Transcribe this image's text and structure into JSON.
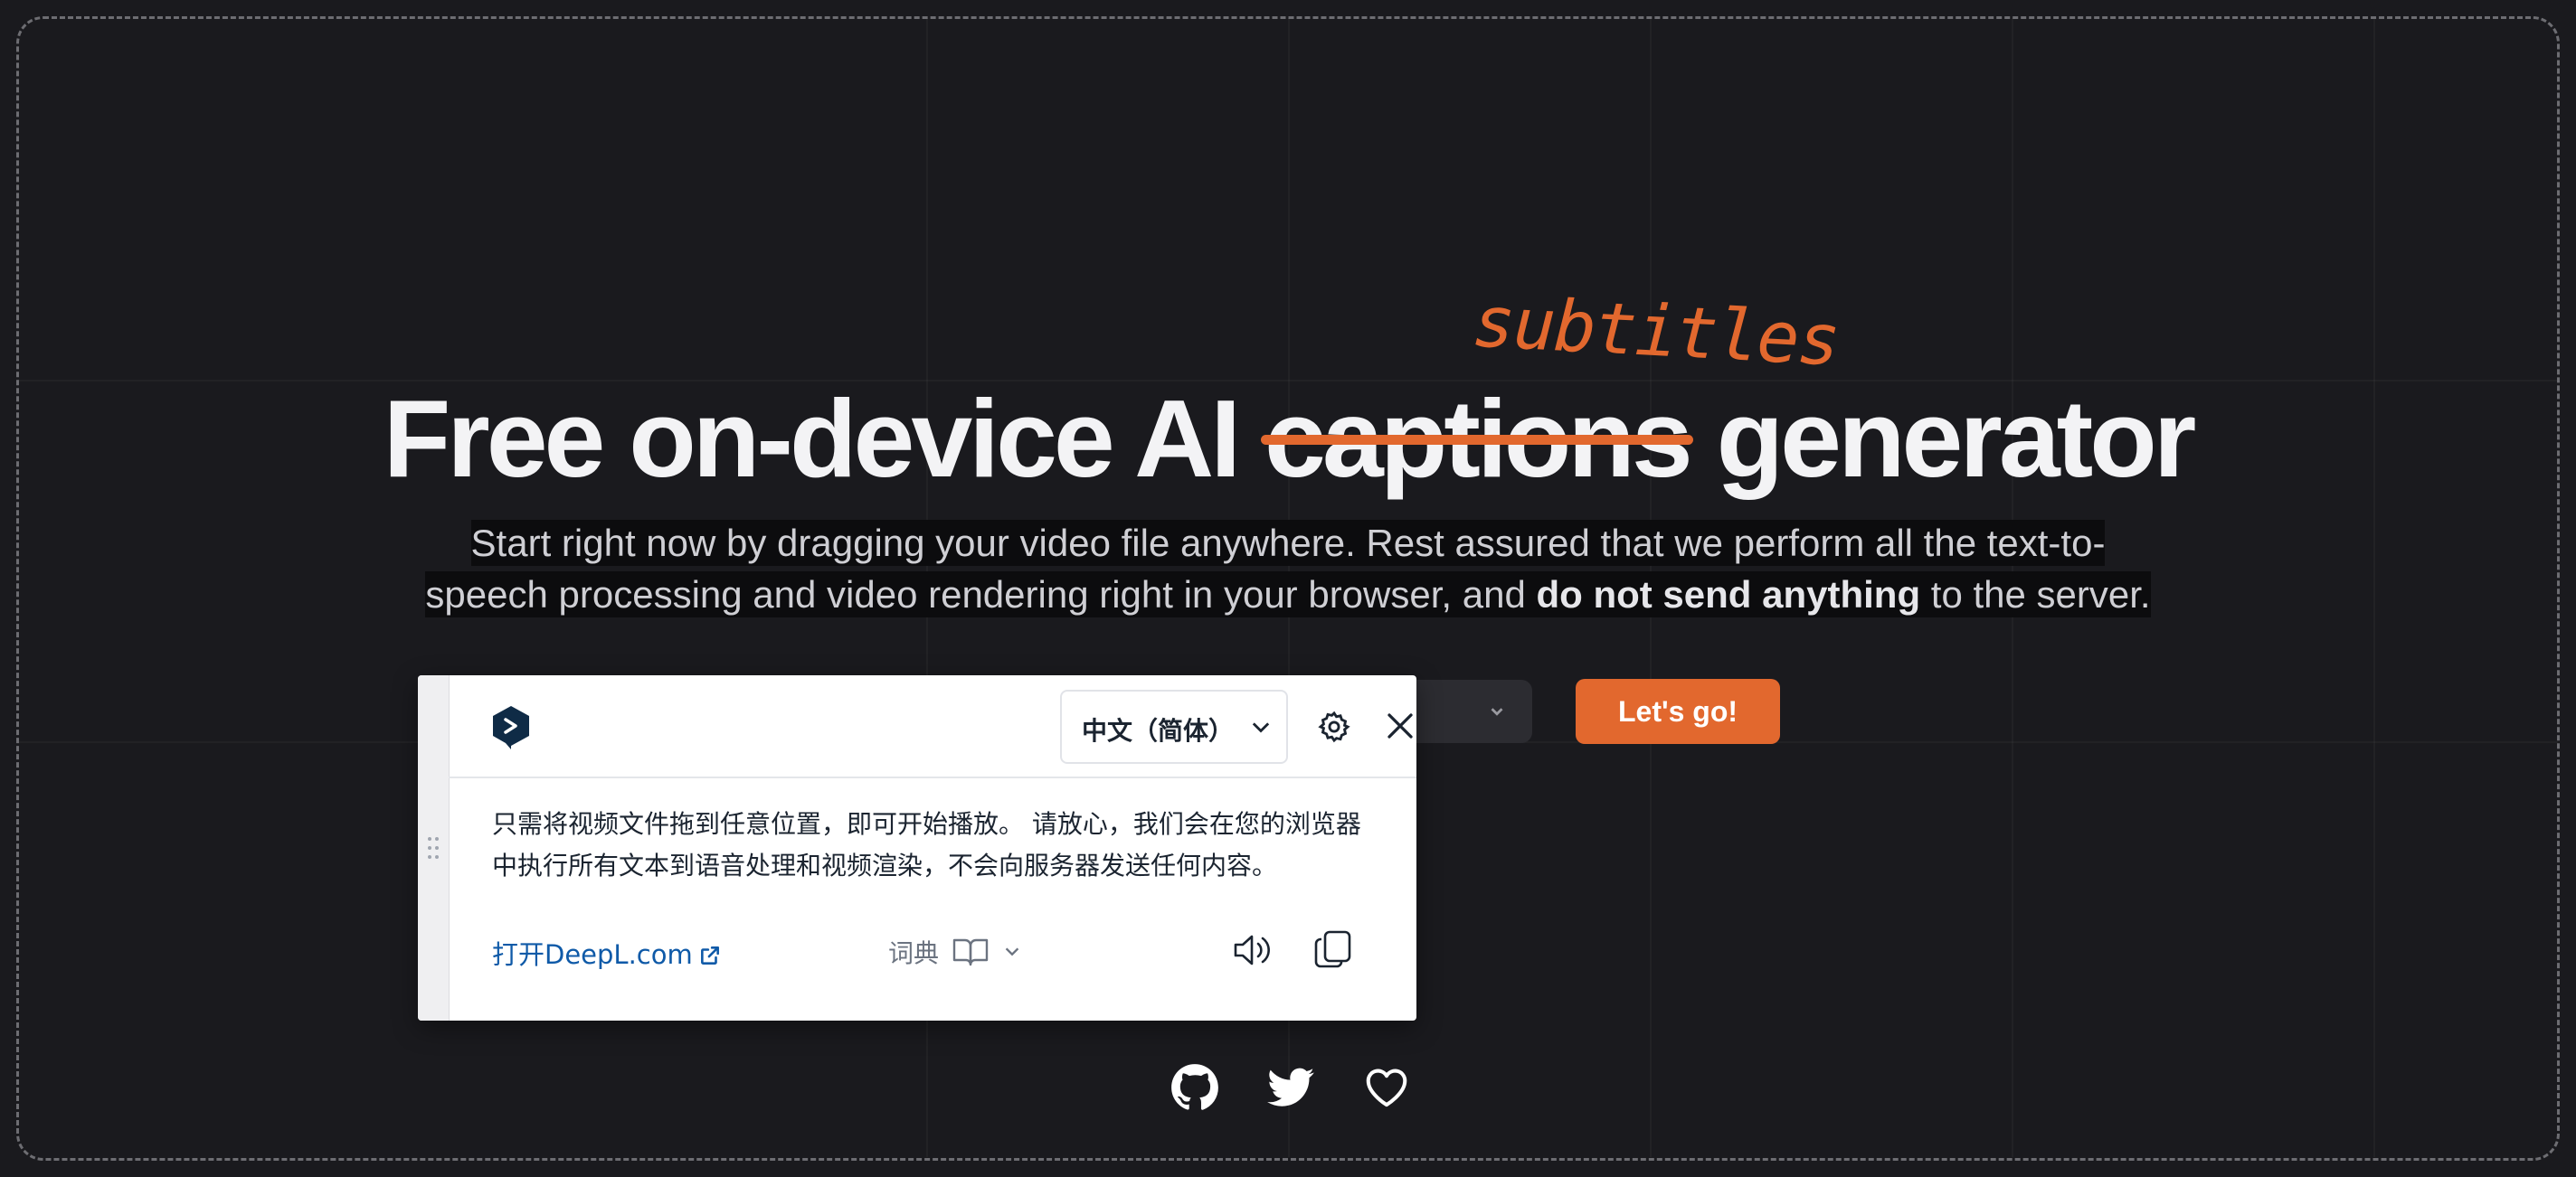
{
  "hero": {
    "title_before": "Free on-device AI ",
    "title_struck": "captions",
    "title_after": " generator",
    "title_replacement": "subtitles",
    "subtext_line1": "Start right now by dragging your video file anywhere. Rest assured that we perform all the text-to-",
    "subtext_line2_start": "speech processing and video rendering right in your browser, and ",
    "subtext_bold": "do not send anything",
    "subtext_end": " to the server."
  },
  "cta": {
    "button_label": "Let's go!"
  },
  "deepl_popup": {
    "target_language": "中文（简体）",
    "translation_line1": "只需将视频文件拖到任意位置，即可开始播放。 请放心，我们会在您的浏览器",
    "translation_line2": "中执行所有文本到语音处理和视频渲染，不会向服务器发送任何内容。",
    "open_link": "打开DeepL.com",
    "dictionary_label": "词典"
  },
  "icons": {
    "github": "github-icon",
    "twitter": "twitter-icon",
    "heart": "heart-icon"
  },
  "colors": {
    "accent": "#e2682e",
    "background": "#1a1a1e",
    "deepl_navy": "#0f2b46"
  }
}
